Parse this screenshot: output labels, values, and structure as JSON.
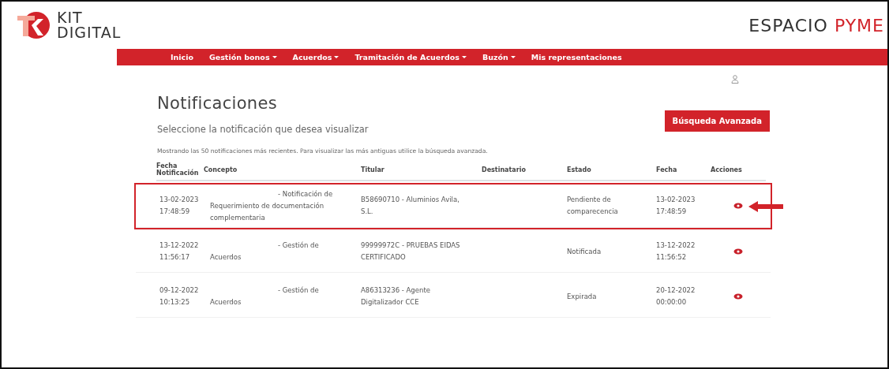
{
  "header": {
    "logo_line1": "KIT",
    "logo_line2": "DIGITAL",
    "brand_part1": "ESPACIO",
    "brand_part2": "PYME"
  },
  "nav": [
    {
      "label": "Inicio",
      "dropdown": false
    },
    {
      "label": "Gestión bonos",
      "dropdown": true
    },
    {
      "label": "Acuerdos",
      "dropdown": true
    },
    {
      "label": "Tramitación de Acuerdos",
      "dropdown": true
    },
    {
      "label": "Buzón",
      "dropdown": true
    },
    {
      "label": "Mis representaciones",
      "dropdown": false
    }
  ],
  "page": {
    "title": "Notificaciones",
    "button": "Búsqueda Avanzada",
    "subtitle": "Seleccione la notificación que desea visualizar",
    "note": "Mostrando las 50 notificaciones más recientes. Para visualizar las más antiguas utilice la búsqueda avanzada."
  },
  "table": {
    "columns": [
      "Fecha Notificación",
      "Concepto",
      "Titular",
      "Destinatario",
      "Estado",
      "Fecha",
      "Acciones"
    ],
    "rows": [
      {
        "fecha_notificacion": "13-02-2023 17:48:59",
        "concepto_prefix": "- Notificación de",
        "concepto": "Requerimiento de documentación complementaria",
        "titular": "B58690710 - Aluminios Avila, S.L.",
        "estado": "Pendiente de comparecencia",
        "fecha": "13-02-2023 17:48:59",
        "highlighted": true
      },
      {
        "fecha_notificacion": "13-12-2022 11:56:17",
        "concepto_prefix": "- Gestión de",
        "concepto": "Acuerdos",
        "titular": "99999972C - PRUEBAS EIDAS CERTIFICADO",
        "estado": "Notificada",
        "fecha": "13-12-2022 11:56:52",
        "highlighted": false
      },
      {
        "fecha_notificacion": "09-12-2022 10:13:25",
        "concepto_prefix": "- Gestión de",
        "concepto": "Acuerdos",
        "titular": "A86313236 - Agente Digitalizador CCE",
        "estado": "Expirada",
        "fecha": "20-12-2022 00:00:00",
        "highlighted": false
      }
    ]
  }
}
